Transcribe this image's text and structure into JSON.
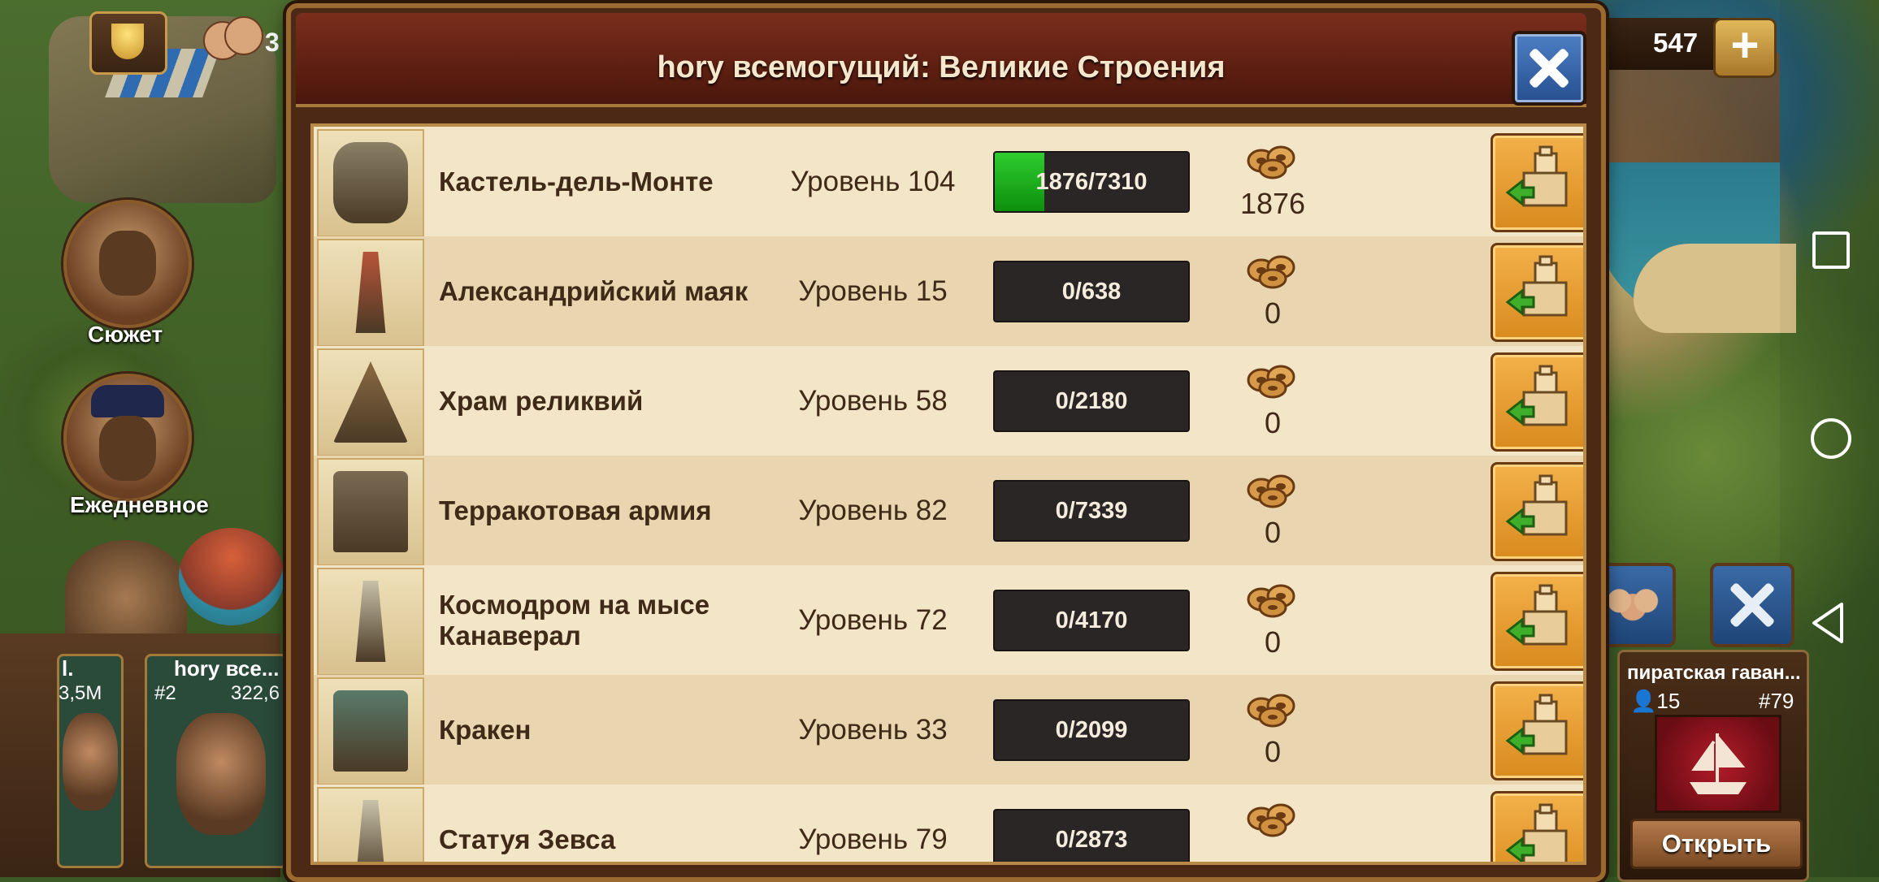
{
  "hud": {
    "left_counter": "3",
    "resource_value": "547",
    "plus_label": "+"
  },
  "portraits": {
    "story_label": "Сюжет",
    "daily_label": "Ежедневное"
  },
  "friends": [
    {
      "name": "l.",
      "score": "3,5M"
    },
    {
      "name": "hory все...",
      "rank": "#2",
      "score": "322,6"
    }
  ],
  "guild_panel": {
    "title": "пиратская гаван...",
    "members": "15",
    "rank": "#79",
    "open_label": "Открыть"
  },
  "modal": {
    "title": "hory всемогущий: Великие Строения",
    "close_icon": "close-x-icon"
  },
  "great_buildings": [
    {
      "name": "Кастель-дель-Монте",
      "level": "Уровень 104",
      "progress": "1876/7310",
      "progress_value": 1876,
      "progress_max": 7310,
      "fp": "1876"
    },
    {
      "name": "Александрийский маяк",
      "level": "Уровень 15",
      "progress": "0/638",
      "progress_value": 0,
      "progress_max": 638,
      "fp": "0"
    },
    {
      "name": "Храм реликвий",
      "level": "Уровень 58",
      "progress": "0/2180",
      "progress_value": 0,
      "progress_max": 2180,
      "fp": "0"
    },
    {
      "name": "Терракотовая армия",
      "level": "Уровень 82",
      "progress": "0/7339",
      "progress_value": 0,
      "progress_max": 7339,
      "fp": "0"
    },
    {
      "name": "Космодром на мысе Канаверал",
      "level": "Уровень 72",
      "progress": "0/4170",
      "progress_value": 0,
      "progress_max": 4170,
      "fp": "0"
    },
    {
      "name": "Кракен",
      "level": "Уровень 33",
      "progress": "0/2099",
      "progress_value": 0,
      "progress_max": 2099,
      "fp": "0"
    },
    {
      "name": "Статуя Зевса",
      "level": "Уровень 79",
      "progress": "0/2873",
      "progress_value": 0,
      "progress_max": 2873,
      "fp": ""
    }
  ],
  "colors": {
    "progress_fill": "#17a317",
    "button_orange": "#e89e2f",
    "close_blue": "#3a6ab0",
    "header_red": "#6a2516"
  }
}
